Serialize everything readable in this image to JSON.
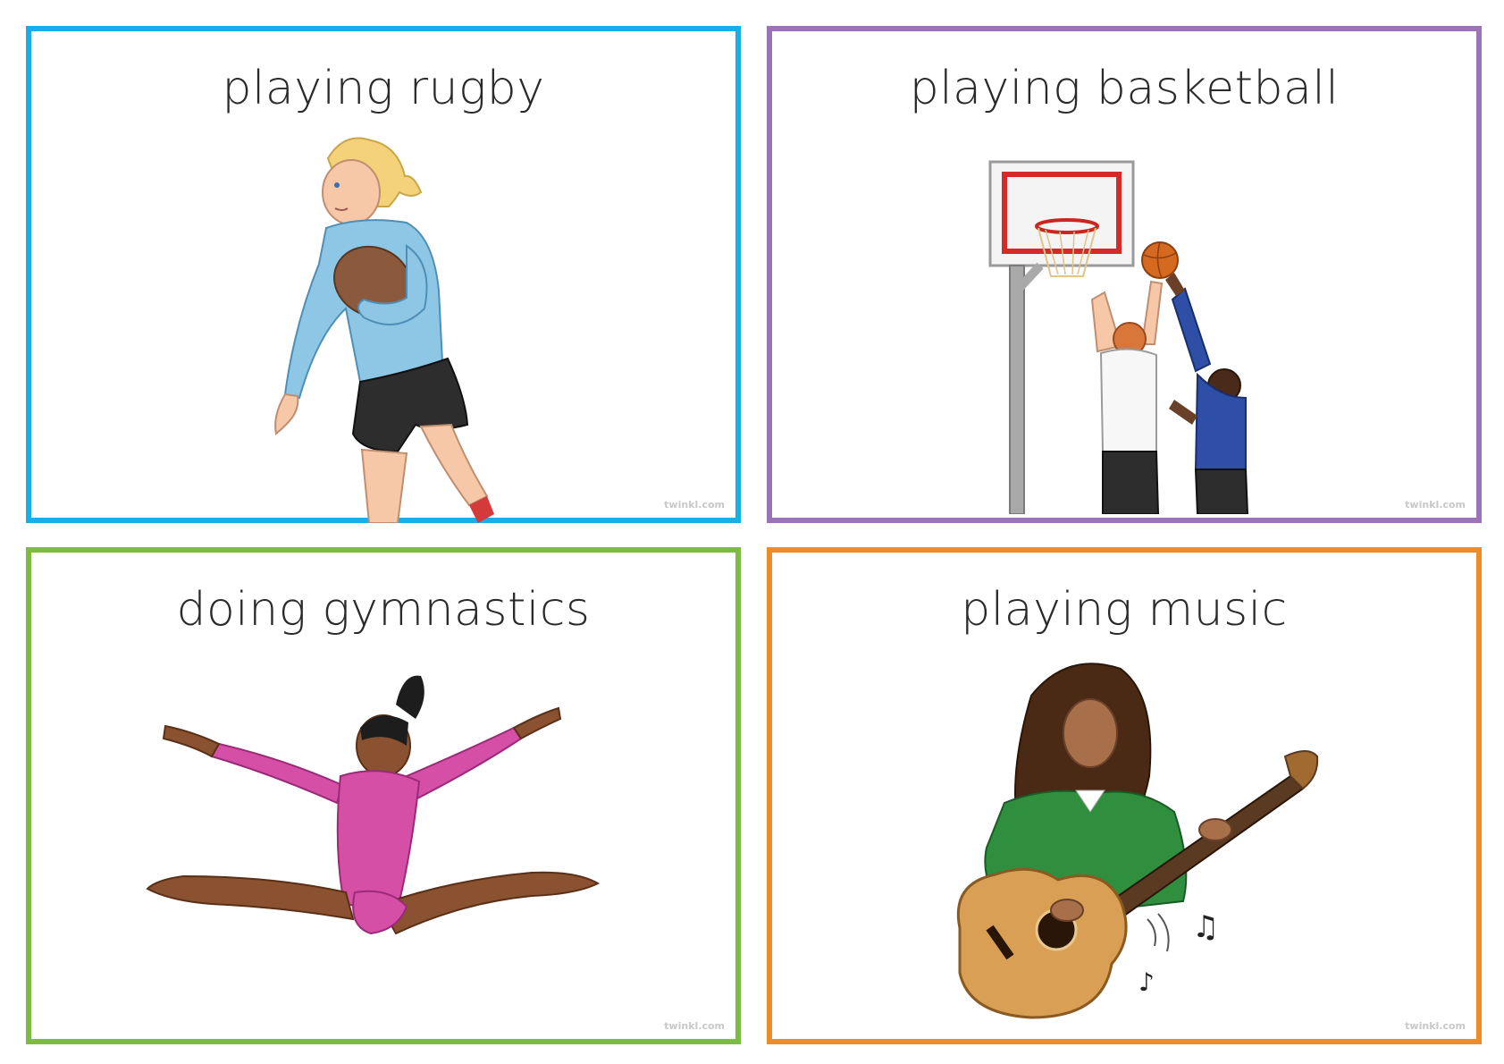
{
  "cards": [
    {
      "title": "playing rugby",
      "border_color": "#1aaee6",
      "watermark": "twinkl.com",
      "illustration": "rugby-player-illustration"
    },
    {
      "title": "playing basketball",
      "border_color": "#9b73b8",
      "watermark": "twinkl.com",
      "illustration": "basketball-players-illustration"
    },
    {
      "title": "doing gymnastics",
      "border_color": "#7dbc42",
      "watermark": "twinkl.com",
      "illustration": "gymnast-illustration"
    },
    {
      "title": "playing music",
      "border_color": "#ee8b2a",
      "watermark": "twinkl.com",
      "illustration": "guitar-player-illustration"
    }
  ]
}
